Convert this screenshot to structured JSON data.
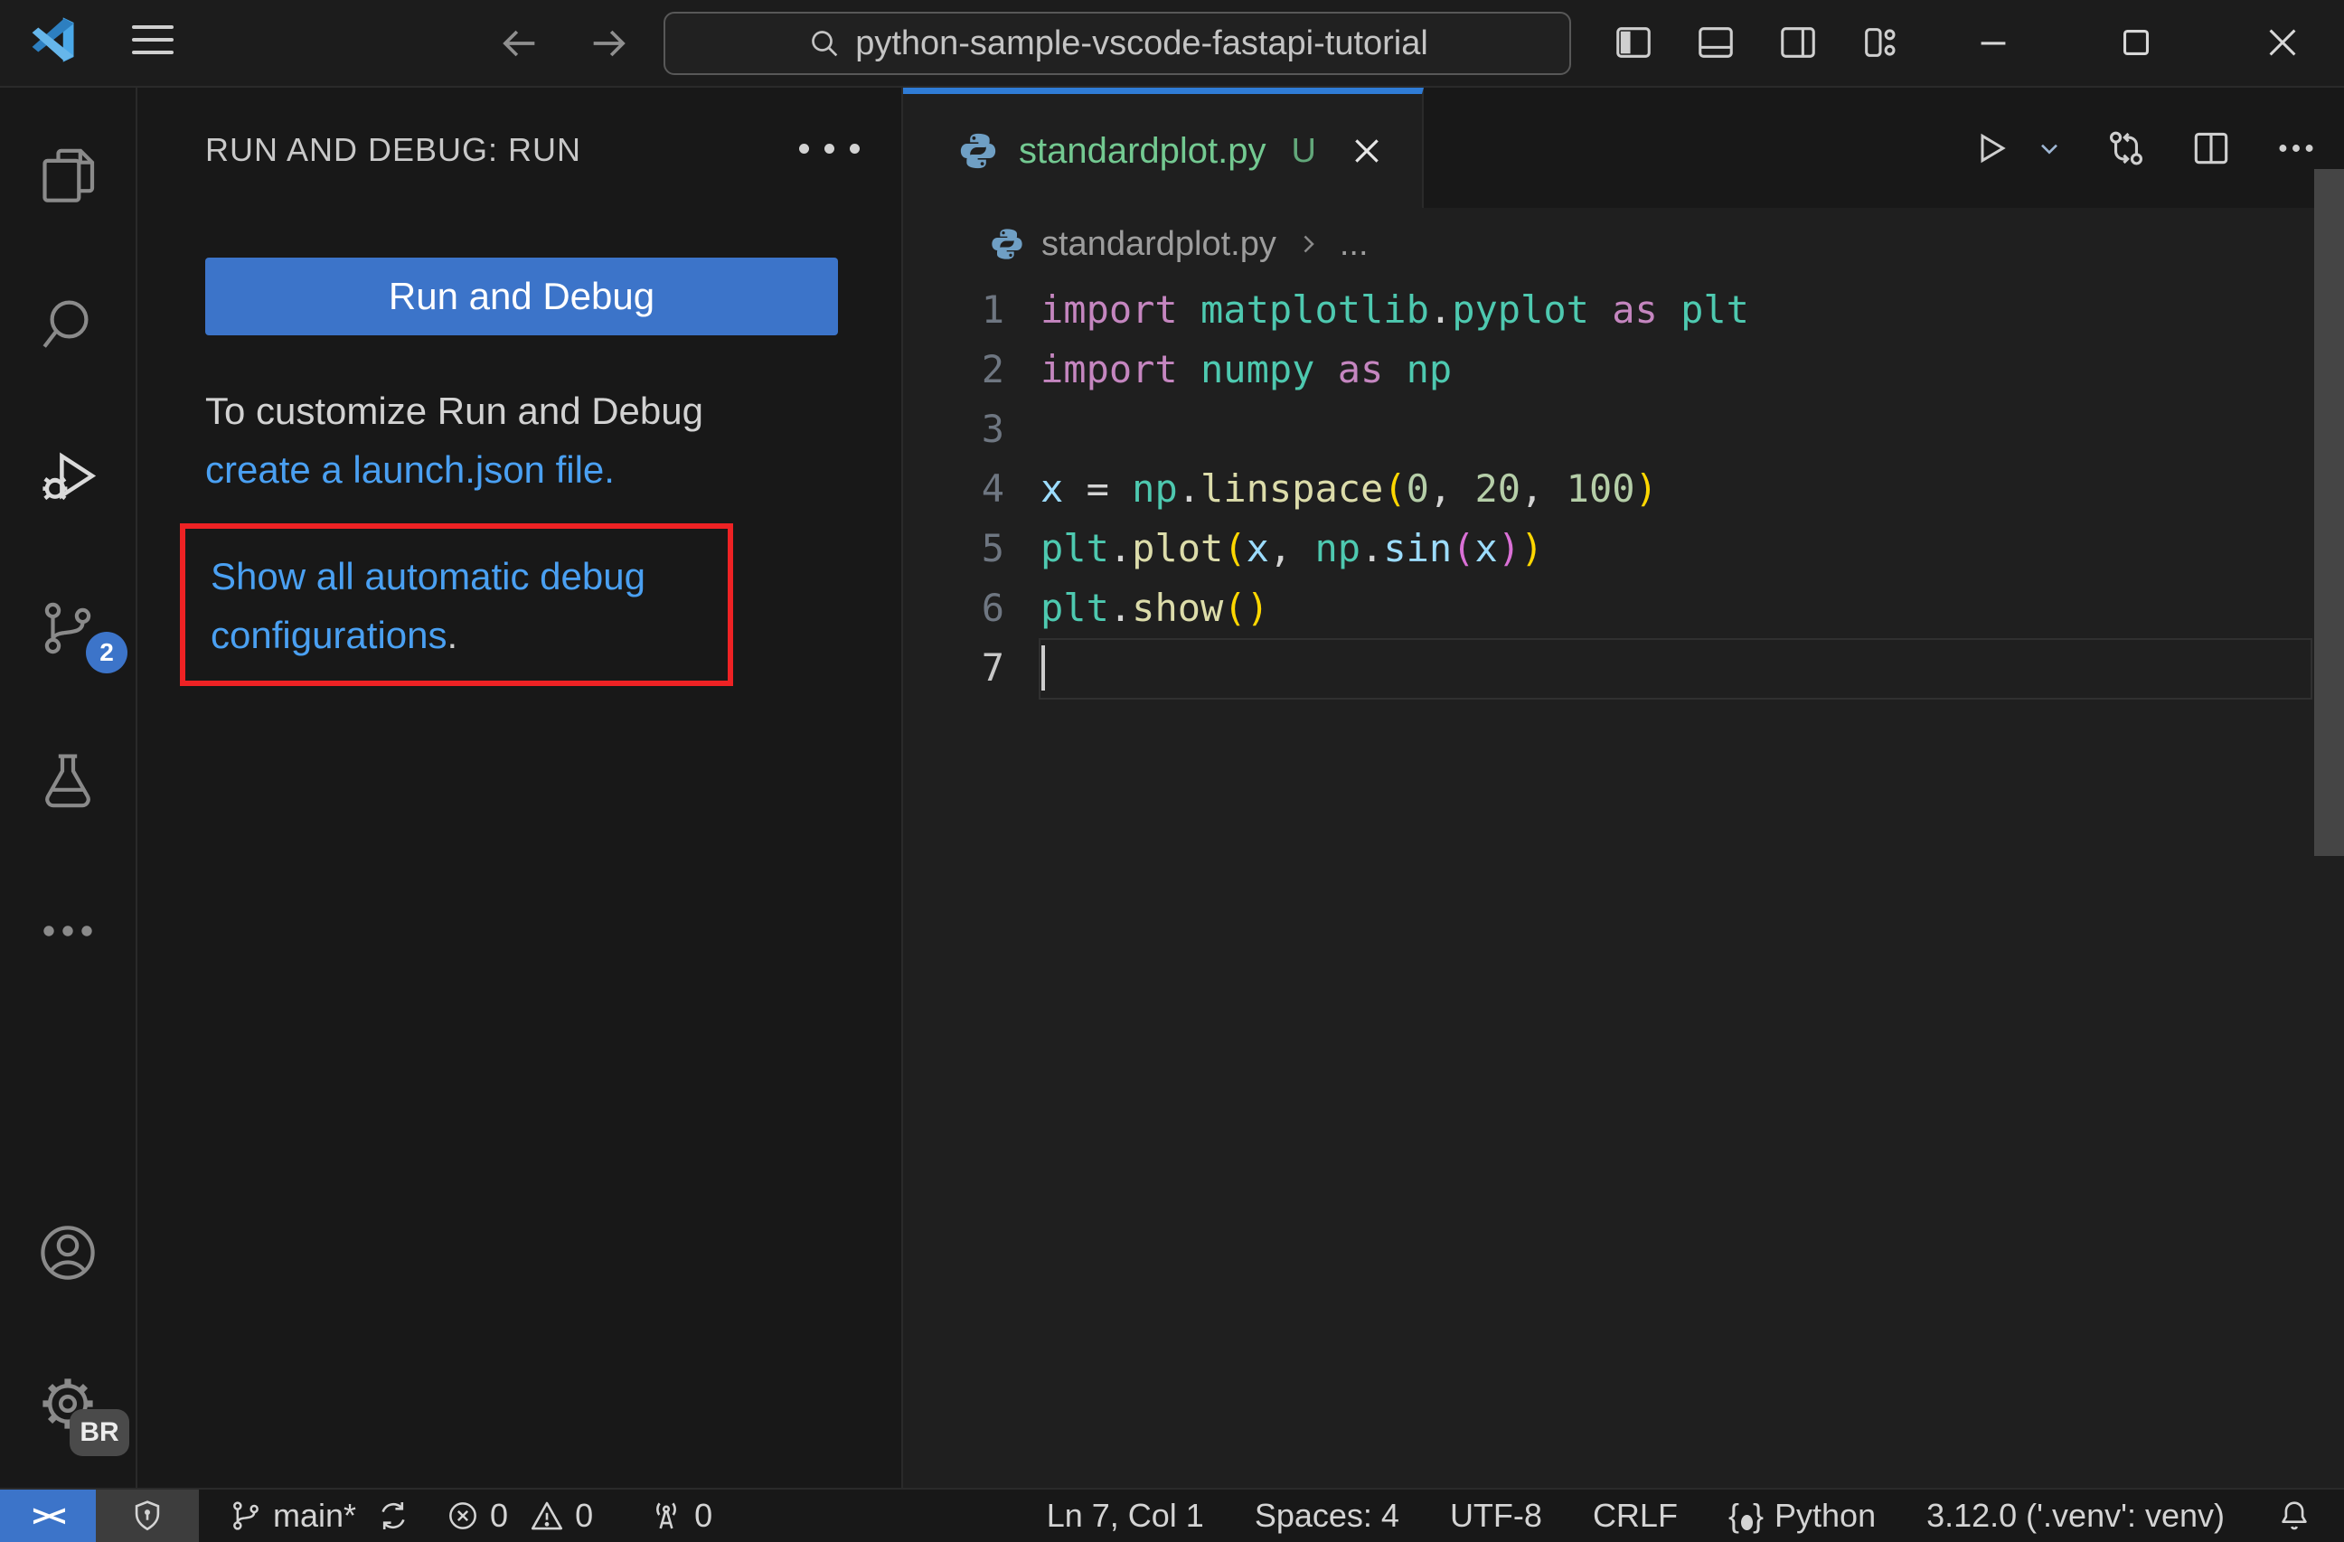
{
  "titlebar": {
    "search_value": "python-sample-vscode-fastapi-tutorial"
  },
  "activitybar": {
    "scm_badge": "2",
    "profile_badge": "BR"
  },
  "sidebar": {
    "header": "RUN AND DEBUG: RUN",
    "run_button": "Run and Debug",
    "customize_line": "To customize Run and Debug",
    "create_link": "create a launch.json file.",
    "show_link": "Show all automatic debug configurations",
    "show_link_period": "."
  },
  "tab": {
    "label": "standardplot.py",
    "git_status": "U"
  },
  "breadcrumb": {
    "file": "standardplot.py",
    "ellipsis": "..."
  },
  "editor": {
    "active_line": 7,
    "lines": [
      [
        [
          "import",
          "kw"
        ],
        [
          " ",
          "pu"
        ],
        [
          "matplotlib",
          "ty"
        ],
        [
          ".",
          "pu"
        ],
        [
          "pyplot",
          "ty"
        ],
        [
          " ",
          "pu"
        ],
        [
          "as",
          "kw"
        ],
        [
          " ",
          "pu"
        ],
        [
          "plt",
          "ty"
        ]
      ],
      [
        [
          "import",
          "kw"
        ],
        [
          " ",
          "pu"
        ],
        [
          "numpy",
          "ty"
        ],
        [
          " ",
          "pu"
        ],
        [
          "as",
          "kw"
        ],
        [
          " ",
          "pu"
        ],
        [
          "np",
          "ty"
        ]
      ],
      [],
      [
        [
          "x",
          "va"
        ],
        [
          " = ",
          "pu"
        ],
        [
          "np",
          "ty"
        ],
        [
          ".",
          "pu"
        ],
        [
          "linspace",
          "fn"
        ],
        [
          "(",
          "b1"
        ],
        [
          "0",
          "nu"
        ],
        [
          ", ",
          "pu"
        ],
        [
          "20",
          "nu"
        ],
        [
          ", ",
          "pu"
        ],
        [
          "100",
          "nu"
        ],
        [
          ")",
          "b1"
        ]
      ],
      [
        [
          "plt",
          "ty"
        ],
        [
          ".",
          "pu"
        ],
        [
          "plot",
          "fn"
        ],
        [
          "(",
          "b1"
        ],
        [
          "x",
          "va"
        ],
        [
          ", ",
          "pu"
        ],
        [
          "np",
          "ty"
        ],
        [
          ".",
          "pu"
        ],
        [
          "sin",
          "va"
        ],
        [
          "(",
          "b2"
        ],
        [
          "x",
          "va"
        ],
        [
          ")",
          "b2"
        ],
        [
          ")",
          "b1"
        ]
      ],
      [
        [
          "plt",
          "ty"
        ],
        [
          ".",
          "pu"
        ],
        [
          "show",
          "fn"
        ],
        [
          "(",
          "b1"
        ],
        [
          ")",
          "b1"
        ]
      ],
      []
    ]
  },
  "statusbar": {
    "remote_glyph": "><",
    "branch": "main*",
    "errors": "0",
    "warnings": "0",
    "ports": "0",
    "line_col": "Ln 7, Col 1",
    "spaces": "Spaces: 4",
    "encoding": "UTF-8",
    "eol": "CRLF",
    "language": "Python",
    "interpreter": "3.12.0 ('.venv': venv)"
  },
  "colors": {
    "accent_blue": "#3c74c9",
    "tab_accent": "#2f7cd6",
    "link": "#4aa0f2",
    "annotation_red": "#ee2224",
    "untracked_green": "#73c991",
    "editor_bg": "#1f1f1f",
    "shell_bg": "#181818"
  }
}
